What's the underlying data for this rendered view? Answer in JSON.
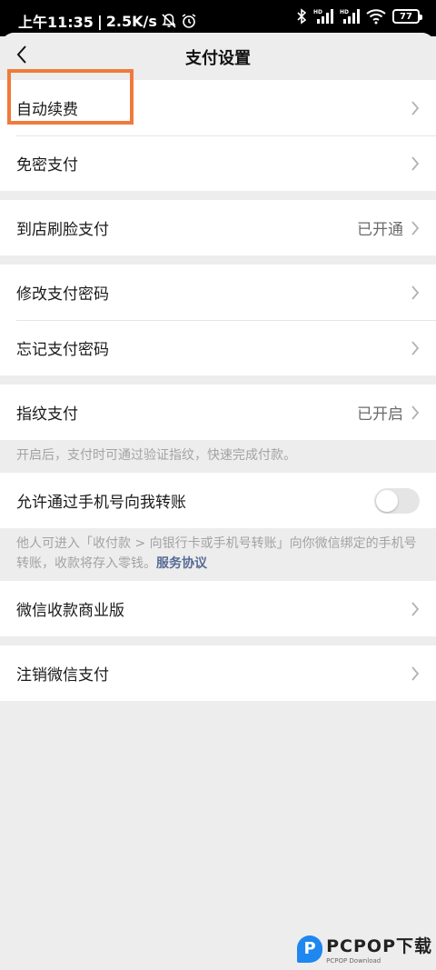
{
  "status_bar": {
    "time": "上午11:35",
    "separator": "|",
    "speed": "2.5K/s",
    "battery": "77",
    "icons": [
      "mute-bell-icon",
      "alarm-icon",
      "bluetooth-icon",
      "signal-hd-icon",
      "signal-hd-icon",
      "wifi-icon",
      "battery-icon"
    ]
  },
  "nav": {
    "title": "支付设置",
    "back_icon": "chevron-left-icon"
  },
  "groups": [
    {
      "rows": [
        {
          "label": "自动续费",
          "value": ""
        },
        {
          "label": "免密支付",
          "value": ""
        }
      ]
    },
    {
      "rows": [
        {
          "label": "到店刷脸支付",
          "value": "已开通"
        }
      ]
    },
    {
      "rows": [
        {
          "label": "修改支付密码",
          "value": ""
        },
        {
          "label": "忘记支付密码",
          "value": ""
        }
      ]
    },
    {
      "rows": [
        {
          "label": "指纹支付",
          "value": "已开启"
        }
      ]
    }
  ],
  "fingerprint_tip": "开启后，支付时可通过验证指纹，快速完成付款。",
  "transfer": {
    "label": "允许通过手机号向我转账",
    "toggle_on": false,
    "tip": "他人可进入「收付款 > 向银行卡或手机号转账」向你微信绑定的手机号转账，收款将存入零钱。",
    "link": "服务协议"
  },
  "merchant": {
    "label": "微信收款商业版"
  },
  "cancel": {
    "label": "注销微信支付"
  },
  "colors": {
    "highlight": "#f07a3c",
    "link": "#576b95",
    "background": "#ededed"
  },
  "watermark": {
    "logo": "P",
    "text": "PCPOP下载",
    "sub": "PCPOP Download"
  }
}
